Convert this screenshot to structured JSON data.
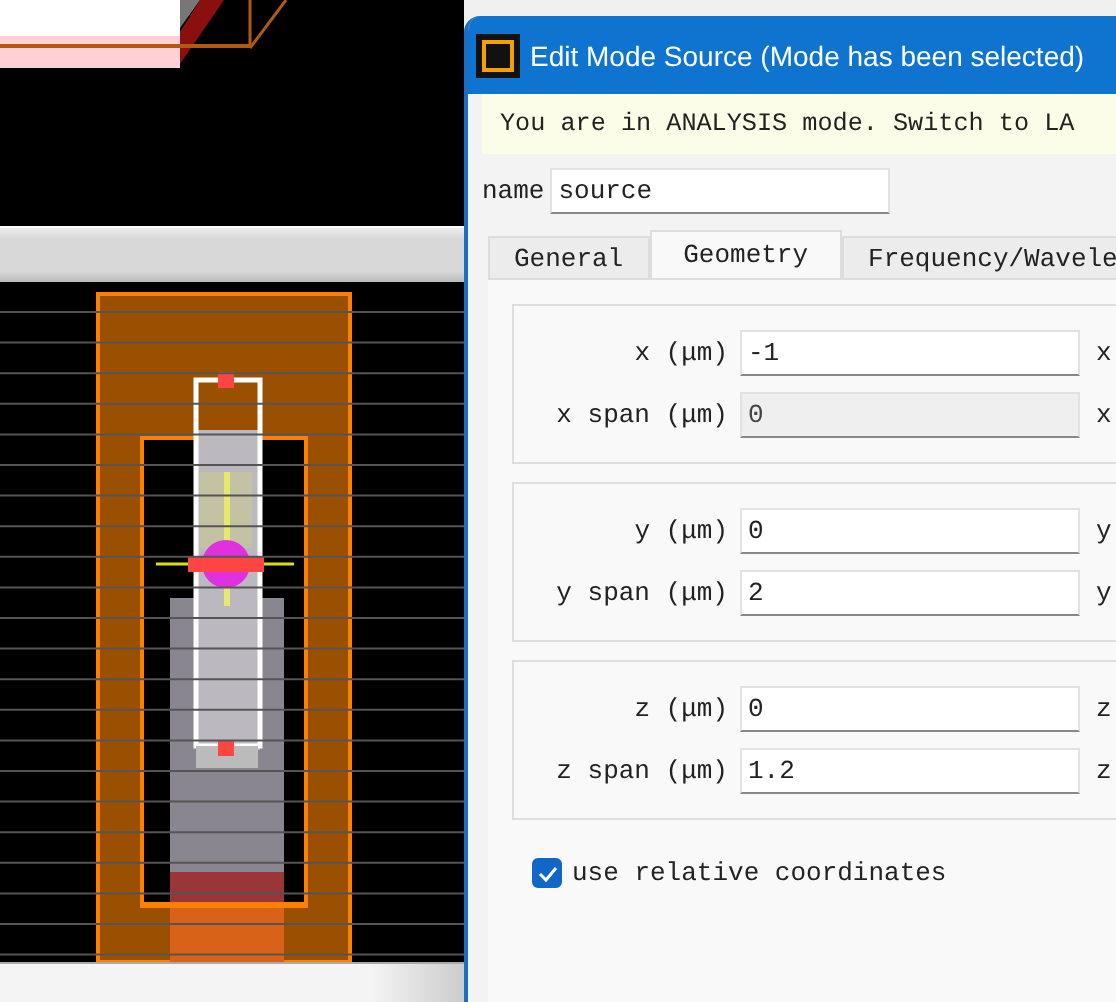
{
  "dialog": {
    "title": "Edit Mode Source (Mode has been selected)",
    "notice": "You are in ANALYSIS mode.  Switch to LA",
    "name_label": "name",
    "name_value": "source",
    "tabs": [
      {
        "label": "General",
        "selected": false
      },
      {
        "label": "Geometry",
        "selected": true
      },
      {
        "label": "Frequency/Wavele",
        "selected": false
      }
    ],
    "groups": [
      {
        "rows": [
          {
            "label": "x (μm)",
            "value": "-1",
            "disabled": false,
            "next_label": "x"
          },
          {
            "label": "x span (μm)",
            "value": "0",
            "disabled": true,
            "next_label": "x"
          }
        ]
      },
      {
        "rows": [
          {
            "label": "y (μm)",
            "value": "0",
            "disabled": false,
            "next_label": "y"
          },
          {
            "label": "y span (μm)",
            "value": "2",
            "disabled": false,
            "next_label": "y"
          }
        ]
      },
      {
        "rows": [
          {
            "label": "z (μm)",
            "value": "0",
            "disabled": false,
            "next_label": "z"
          },
          {
            "label": "z span (μm)",
            "value": "1.2",
            "disabled": false,
            "next_label": "z"
          }
        ]
      }
    ],
    "checkbox": {
      "label": "use relative coordinates",
      "checked": true
    }
  }
}
